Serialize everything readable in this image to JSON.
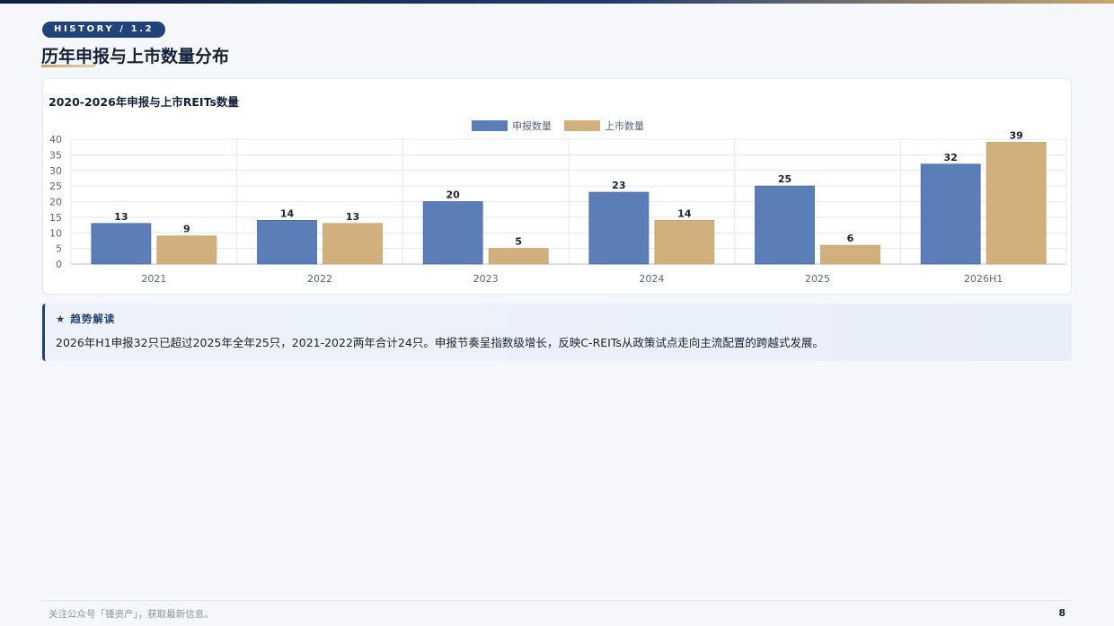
{
  "header": {
    "section_tag": "HISTORY / 1.2",
    "title": "历年申报与上市数量分布"
  },
  "colors": {
    "primary": "#5b7db8",
    "gold": "#d2b07e",
    "navy": "#22427a"
  },
  "chart_data": {
    "type": "bar",
    "title": "2020-2026年申报与上市REITs数量",
    "categories": [
      "2021",
      "2022",
      "2023",
      "2024",
      "2025",
      "2026H1"
    ],
    "series": [
      {
        "name": "申报数量",
        "values": [
          13,
          14,
          20,
          23,
          25,
          32
        ],
        "color": "#5b7db8"
      },
      {
        "name": "上市数量",
        "values": [
          9,
          13,
          5,
          14,
          6,
          39
        ],
        "color": "#d2b07e"
      }
    ],
    "ylim": [
      0,
      40
    ],
    "yticks": [
      0,
      5,
      10,
      15,
      20,
      25,
      30,
      35,
      40
    ],
    "grid": true,
    "legend": "top-center",
    "data_labels": true
  },
  "insight": {
    "heading": "★ 趋势解读",
    "text": "2026年H1申报32只已超过2025年全年25只，2021-2022两年合计24只。申报节奏呈指数级增长，反映C-REITs从政策试点走向主流配置的跨越式发展。"
  },
  "footer": {
    "note": "关注公众号「锺资产」，获取最新信息。",
    "page": "8"
  }
}
